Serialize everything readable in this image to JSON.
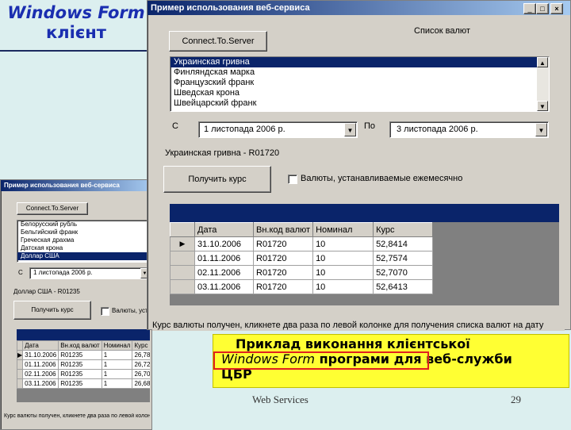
{
  "slide": {
    "title_line1": "Windows Form",
    "title_line2": "клієнт",
    "footer_center": "Web Services",
    "page_number": "29",
    "caption_line1": "Приклад виконання клієнтської",
    "caption_wf": "Windows Form",
    "caption_prog": "програми",
    "caption_rest": "для веб-служби",
    "caption_line3": "ЦБР"
  },
  "main_window": {
    "title": "Пример использования веб-сервиса",
    "connect_button": "Connect.To.Server",
    "currency_list_label": "Список валют",
    "currencies": [
      "Украинская гривна",
      "Финляндская марка",
      "Французский франк",
      "Шведская крона",
      "Швейцарский франк"
    ],
    "selected_currency_index": 0,
    "from_label": "С",
    "from_date": "1 листопада 2006 р.",
    "to_label": "По",
    "to_date": "3 листопада 2006 р.",
    "selected_info": "Украинская гривна - R01720",
    "get_rate_button": "Получить курс",
    "monthly_checkbox_label": "Валюты, устанавливаемые ежемесячно",
    "grid": {
      "columns": [
        "Дата",
        "Вн.код валют",
        "Номинал",
        "Курс"
      ],
      "rows": [
        [
          "31.10.2006",
          "R01720",
          "10",
          "52,8414"
        ],
        [
          "01.11.2006",
          "R01720",
          "10",
          "52,7574"
        ],
        [
          "02.11.2006",
          "R01720",
          "10",
          "52,7070"
        ],
        [
          "03.11.2006",
          "R01720",
          "10",
          "52,6413"
        ]
      ],
      "current_row_marker": "▶"
    },
    "status_text": "Курс валюты получен, кликнете два раза по левой колонке для получения списка валют на дату"
  },
  "back_window": {
    "title": "Пример использования веб-сервиса",
    "connect_button": "Connect.To.Server",
    "currencies": [
      "Белорусский рубль",
      "Бельгийский франк",
      "Греческая драхма",
      "Датская крона",
      "Доллар США"
    ],
    "selected_currency_index": 4,
    "from_label": "С",
    "from_date": "1 листопада 2006 р.",
    "selected_info": "Доллар США - R01235",
    "get_rate_button": "Получить курс",
    "monthly_checkbox_label": "Валюты, уста",
    "grid": {
      "columns": [
        "Дата",
        "Вн.код валют",
        "Номинал",
        "Курс"
      ],
      "rows": [
        [
          "31.10.2006",
          "R01235",
          "1",
          "26,7811"
        ],
        [
          "01.11.2006",
          "R01235",
          "1",
          "26,7285"
        ],
        [
          "02.11.2006",
          "R01235",
          "1",
          "26,7070"
        ],
        [
          "03.11.2006",
          "R01235",
          "1",
          "26,6815"
        ]
      ],
      "current_row_marker": "▶"
    },
    "status_text": "Курс валюты получен, кликнете два раза по левой колонке для получения списка валют на дату"
  },
  "icons": {
    "minimize": "minimize-icon",
    "maximize": "maximize-icon",
    "close": "close-icon",
    "dropdown": "chevron-down-icon",
    "scroll_up": "scroll-up-icon",
    "scroll_down": "scroll-down-icon",
    "row_pointer": "row-pointer-icon"
  },
  "colors": {
    "slide_bg": "#dcefef",
    "title_blue": "#1a2eb0",
    "caption_yellow": "#ffff33",
    "highlight_red": "#e02020",
    "titlebar": "#0a246a"
  }
}
